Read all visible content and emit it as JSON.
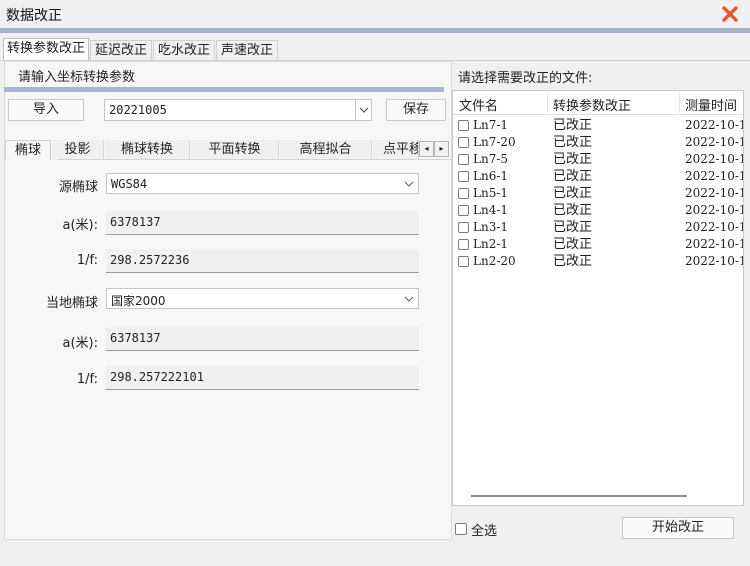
{
  "window": {
    "title": "数据改正",
    "close_icon": "close-icon",
    "accent": "#e8572a"
  },
  "main_tabs": [
    "转换参数改正",
    "延迟改正",
    "吃水改正",
    "声速改正"
  ],
  "left": {
    "section_title": "请输入坐标转换参数",
    "import_label": "导入",
    "date_value": "20221005",
    "save_label": "保存",
    "sub_tabs": [
      "椭球",
      "投影",
      "椭球转换",
      "平面转换",
      "高程拟合",
      "点平移"
    ],
    "source": {
      "label": "源椭球",
      "value": "WGS84",
      "a_label": "a(米):",
      "a_value": "6378137",
      "f_label": "1/f:",
      "f_value": "298.2572236"
    },
    "local": {
      "label": "当地椭球",
      "value": "国家2000",
      "a_label": "a(米):",
      "a_value": "6378137",
      "f_label": "1/f:",
      "f_value": "298.257222101"
    }
  },
  "right": {
    "section_title": "请选择需要改正的文件:",
    "columns": [
      "文件名",
      "转换参数改正",
      "测量时间"
    ],
    "rows": [
      {
        "name": "Ln7-1",
        "status": "已改正",
        "time": "2022-10-1"
      },
      {
        "name": "Ln7-20",
        "status": "已改正",
        "time": "2022-10-1"
      },
      {
        "name": "Ln7-5",
        "status": "已改正",
        "time": "2022-10-1"
      },
      {
        "name": "Ln6-1",
        "status": "已改正",
        "time": "2022-10-1"
      },
      {
        "name": "Ln5-1",
        "status": "已改正",
        "time": "2022-10-1"
      },
      {
        "name": "Ln4-1",
        "status": "已改正",
        "time": "2022-10-1"
      },
      {
        "name": "Ln3-1",
        "status": "已改正",
        "time": "2022-10-1"
      },
      {
        "name": "Ln2-1",
        "status": "已改正",
        "time": "2022-10-1"
      },
      {
        "name": "Ln2-20",
        "status": "已改正",
        "time": "2022-10-1"
      }
    ],
    "select_all_label": "全选",
    "start_label": "开始改正"
  }
}
